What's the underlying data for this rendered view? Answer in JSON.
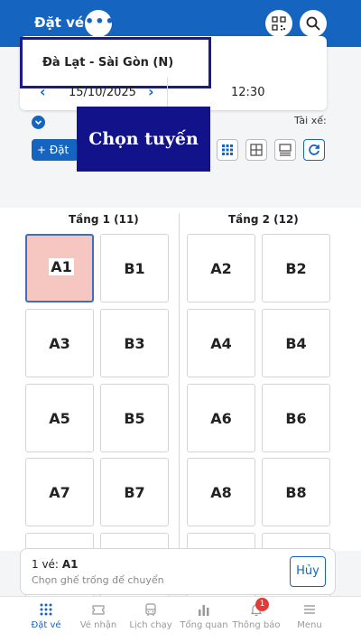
{
  "header": {
    "title": "Đặt vé",
    "more_icon": "more-dots-icon",
    "qr_icon": "qr-code-icon",
    "search_icon": "search-icon",
    "background": "#1565c0"
  },
  "booking": {
    "route": "Đà Lạt - Sài Gòn (N)",
    "date": "15/10/2025",
    "time": "12:30",
    "driver_label": "Tài xế:",
    "add_button": "+ Đặt"
  },
  "overlay": {
    "label": "Chọn tuyến"
  },
  "view_buttons": [
    {
      "icon": "grid-small-icon",
      "active": true
    },
    {
      "icon": "grid-large-icon",
      "active": false
    },
    {
      "icon": "list-view-icon",
      "active": false
    },
    {
      "icon": "refresh-icon",
      "active": true
    }
  ],
  "floors": [
    {
      "title": "Tầng 1 (11)",
      "seats": [
        "A1",
        "B1",
        "A3",
        "B3",
        "A5",
        "B5",
        "A7",
        "B7"
      ]
    },
    {
      "title": "Tầng 2 (12)",
      "seats": [
        "A2",
        "B2",
        "A4",
        "B4",
        "A6",
        "B6",
        "A8",
        "B8"
      ]
    }
  ],
  "selected_seat": "A1",
  "summary": {
    "prefix": "1 vé:",
    "seat": "A1",
    "hint": "Chọn ghế trống để chuyển",
    "cancel": "Hủy"
  },
  "nav": {
    "items": [
      {
        "label": "Đặt vé",
        "icon": "seat-grid-icon",
        "active": true
      },
      {
        "label": "Vé nhận",
        "icon": "ticket-icon",
        "active": false
      },
      {
        "label": "Lịch chạy",
        "icon": "bus-icon",
        "active": false
      },
      {
        "label": "Tổng quan",
        "icon": "bar-chart-icon",
        "active": false
      },
      {
        "label": "Thông báo",
        "icon": "bell-icon",
        "active": false
      },
      {
        "label": "Menu",
        "icon": "menu-icon",
        "active": false
      }
    ],
    "notification_count": "1"
  }
}
